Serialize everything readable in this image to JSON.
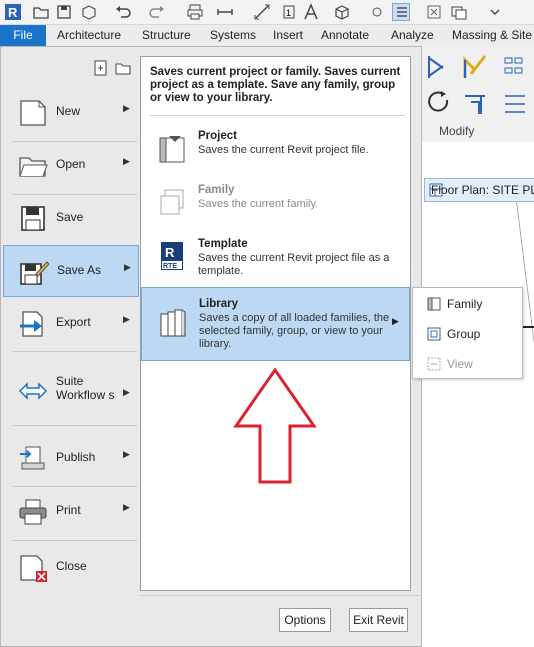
{
  "ribbon": {
    "file_tab": "File",
    "tabs": [
      "Architecture",
      "Structure",
      "Systems",
      "Insert",
      "Annotate",
      "Analyze",
      "Massing & Site"
    ],
    "modify_label": "Modify",
    "view_tab": "Floor Plan: SITE PLA"
  },
  "menu": {
    "items": [
      {
        "label": "New",
        "icon": "new-document-icon",
        "has_arrow": true
      },
      {
        "label": "Open",
        "icon": "folder-icon",
        "has_arrow": true
      },
      {
        "label": "Save",
        "icon": "floppy-icon",
        "has_arrow": false
      },
      {
        "label": "Save As",
        "icon": "save-as-icon",
        "has_arrow": true
      },
      {
        "label": "Export",
        "icon": "export-icon",
        "has_arrow": true
      },
      {
        "label": "Suite Workflow s",
        "icon": "suite-workflows-icon",
        "has_arrow": true
      },
      {
        "label": "Publish",
        "icon": "publish-icon",
        "has_arrow": true
      },
      {
        "label": "Print",
        "icon": "printer-icon",
        "has_arrow": true
      },
      {
        "label": "Close",
        "icon": "close-document-icon",
        "has_arrow": false
      }
    ]
  },
  "panel": {
    "description": "Saves current project or family. Saves current project as a template. Save any family, group or view to your library.",
    "options": [
      {
        "title": "Project",
        "desc": "Saves the current Revit project file.",
        "icon": "project-icon"
      },
      {
        "title": "Family",
        "desc": "Saves the current family.",
        "icon": "family-icon",
        "disabled": true
      },
      {
        "title": "Template",
        "desc": "Saves the current Revit project file as a template.",
        "icon": "rte-template-icon",
        "badge": "RTE"
      },
      {
        "title": "Library",
        "desc": "Saves a copy of all loaded families, the selected family, group, or view to your library.",
        "icon": "library-icon"
      }
    ],
    "options_button": "Options",
    "exit_button": "Exit Revit"
  },
  "flyout": {
    "items": [
      {
        "label": "Family",
        "icon": "family-small-icon"
      },
      {
        "label": "Group",
        "icon": "group-small-icon"
      },
      {
        "label": "View",
        "icon": "view-small-icon",
        "disabled": true
      }
    ]
  },
  "colors": {
    "file_tab": "#1a74c9",
    "highlight": "#bcd8f2",
    "arrow": "#d9232e"
  },
  "app_logo_letter": "R"
}
